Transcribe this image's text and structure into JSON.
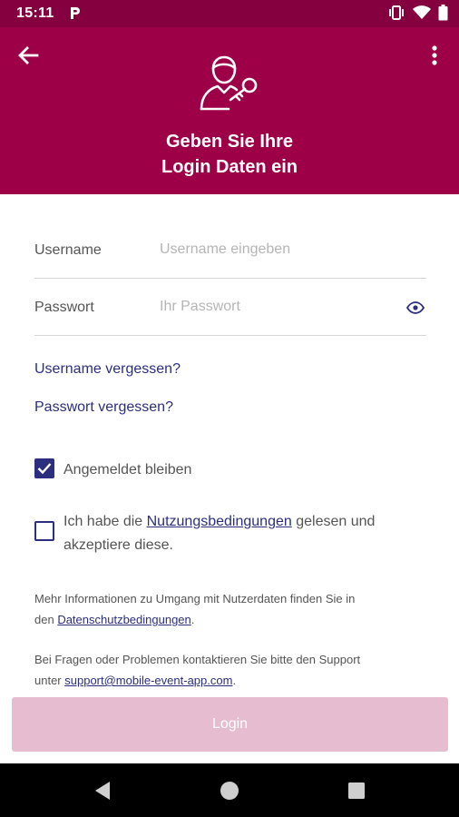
{
  "status_bar": {
    "time": "15:11",
    "icons": [
      "parking-icon",
      "vibrate-icon",
      "wifi-icon",
      "battery-icon"
    ]
  },
  "header": {
    "title_line1": "Geben Sie Ihre",
    "title_line2": "Login Daten ein",
    "icons": [
      "back-arrow-icon",
      "more-vert-icon",
      "user-key-icon"
    ],
    "background_color": "#9e0048"
  },
  "form": {
    "username": {
      "label": "Username",
      "placeholder": "Username eingeben",
      "value": ""
    },
    "password": {
      "label": "Passwort",
      "placeholder": "Ihr Passwort",
      "value": ""
    }
  },
  "links": {
    "forgot_username": "Username vergessen?",
    "forgot_password": "Passwort vergessen?"
  },
  "stay_logged_in": {
    "label": "Angemeldet bleiben",
    "checked": true
  },
  "terms": {
    "checked": false,
    "prefix": "Ich habe die ",
    "link": "Nutzungsbedingungen",
    "suffix_line1": " gelesen und",
    "line2": "akzeptiere diese."
  },
  "privacy_info": {
    "line1": "Mehr Informationen zu Umgang mit Nutzerdaten finden Sie in",
    "prefix": "den ",
    "link": "Datenschutzbedingungen",
    "suffix": "."
  },
  "support_info": {
    "line1": "Bei Fragen oder Problemen kontaktieren Sie bitte den Support",
    "prefix": "unter ",
    "link": "support@mobile-event-app.com",
    "suffix": "."
  },
  "login_button": {
    "label": "Login",
    "enabled": false,
    "color": "#e6bdd0"
  },
  "nav_bar": {
    "icons": [
      "back-triangle-icon",
      "home-circle-icon",
      "recents-square-icon"
    ]
  },
  "colors": {
    "accent": "#2b2f7e",
    "brand": "#9e0048",
    "status_bar": "#85003f"
  }
}
